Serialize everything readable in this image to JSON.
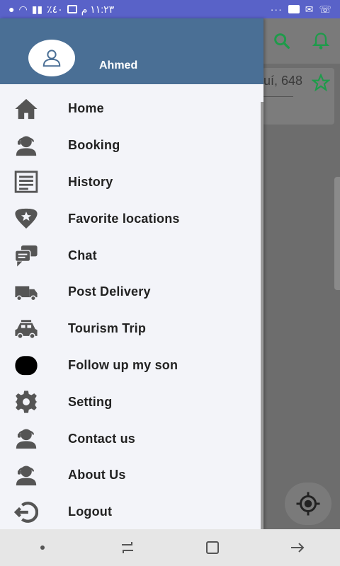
{
  "status_bar": {
    "time": "١١:٢٣ م",
    "battery": "٤٠٪",
    "dots": "···"
  },
  "background": {
    "address_snippet": "uí, 648"
  },
  "drawer": {
    "user_name": "Ahmed",
    "items": [
      {
        "label": "Home",
        "icon": "home-icon"
      },
      {
        "label": "Booking",
        "icon": "person-headset-icon"
      },
      {
        "label": "History",
        "icon": "list-document-icon"
      },
      {
        "label": "Favorite locations",
        "icon": "favorite-location-icon"
      },
      {
        "label": "Chat",
        "icon": "chat-icon"
      },
      {
        "label": "Post Delivery",
        "icon": "truck-icon"
      },
      {
        "label": "Tourism Trip",
        "icon": "car-icon"
      },
      {
        "label": "Follow up my son",
        "icon": "blob-icon"
      },
      {
        "label": "Setting",
        "icon": "gear-icon"
      },
      {
        "label": "Contact us",
        "icon": "person-headset-icon"
      },
      {
        "label": "About Us",
        "icon": "person-headset-icon"
      },
      {
        "label": "Logout",
        "icon": "logout-icon"
      }
    ]
  },
  "colors": {
    "status_bar": "#5962c8",
    "drawer_header": "#4a6f95",
    "accent_green": "#1e9b4a",
    "icon_gray": "#555555"
  }
}
